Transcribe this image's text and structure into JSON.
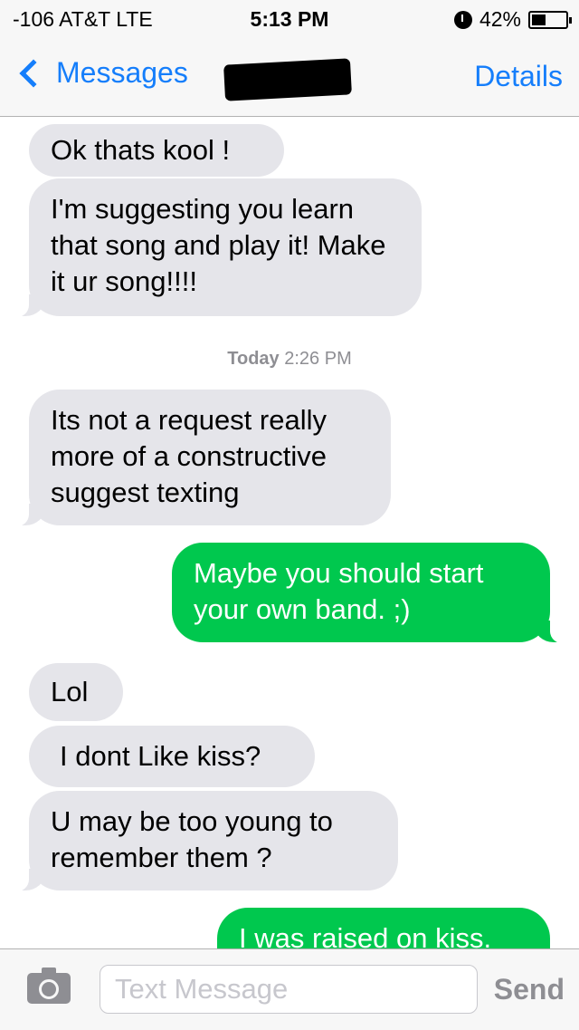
{
  "status_bar": {
    "carrier": "-106 AT&T  LTE",
    "time": "5:13 PM",
    "battery": "42%",
    "battery_level": 0.42,
    "icons": [
      "alarm-icon",
      "battery-icon"
    ]
  },
  "nav": {
    "back_label": "Messages",
    "details_label": "Details",
    "contact_name_redacted": true
  },
  "conversation": {
    "timestamp_day": "Today",
    "timestamp_time": "2:26 PM",
    "messages": [
      {
        "direction": "incoming",
        "text": "Ok thats kool !"
      },
      {
        "direction": "incoming",
        "text": "I'm suggesting you learn that song and play it! Make it ur song!!!!"
      },
      {
        "direction": "incoming",
        "text": "Its not a request really more of a constructive suggest texting"
      },
      {
        "direction": "outgoing",
        "text": "Maybe you should start your own band. ;)"
      },
      {
        "direction": "incoming",
        "text": "Lol"
      },
      {
        "direction": "incoming",
        "text": "I dont Like kiss?"
      },
      {
        "direction": "incoming",
        "text": "U may be too young to remember them ?"
      },
      {
        "direction": "outgoing",
        "text": "I was raised on kiss."
      }
    ]
  },
  "input_bar": {
    "placeholder": "Text Message",
    "value": "",
    "send_label": "Send"
  },
  "colors": {
    "accent": "#157efb",
    "incoming_bubble": "#e5e5ea",
    "outgoing_bubble": "#00c84e"
  }
}
